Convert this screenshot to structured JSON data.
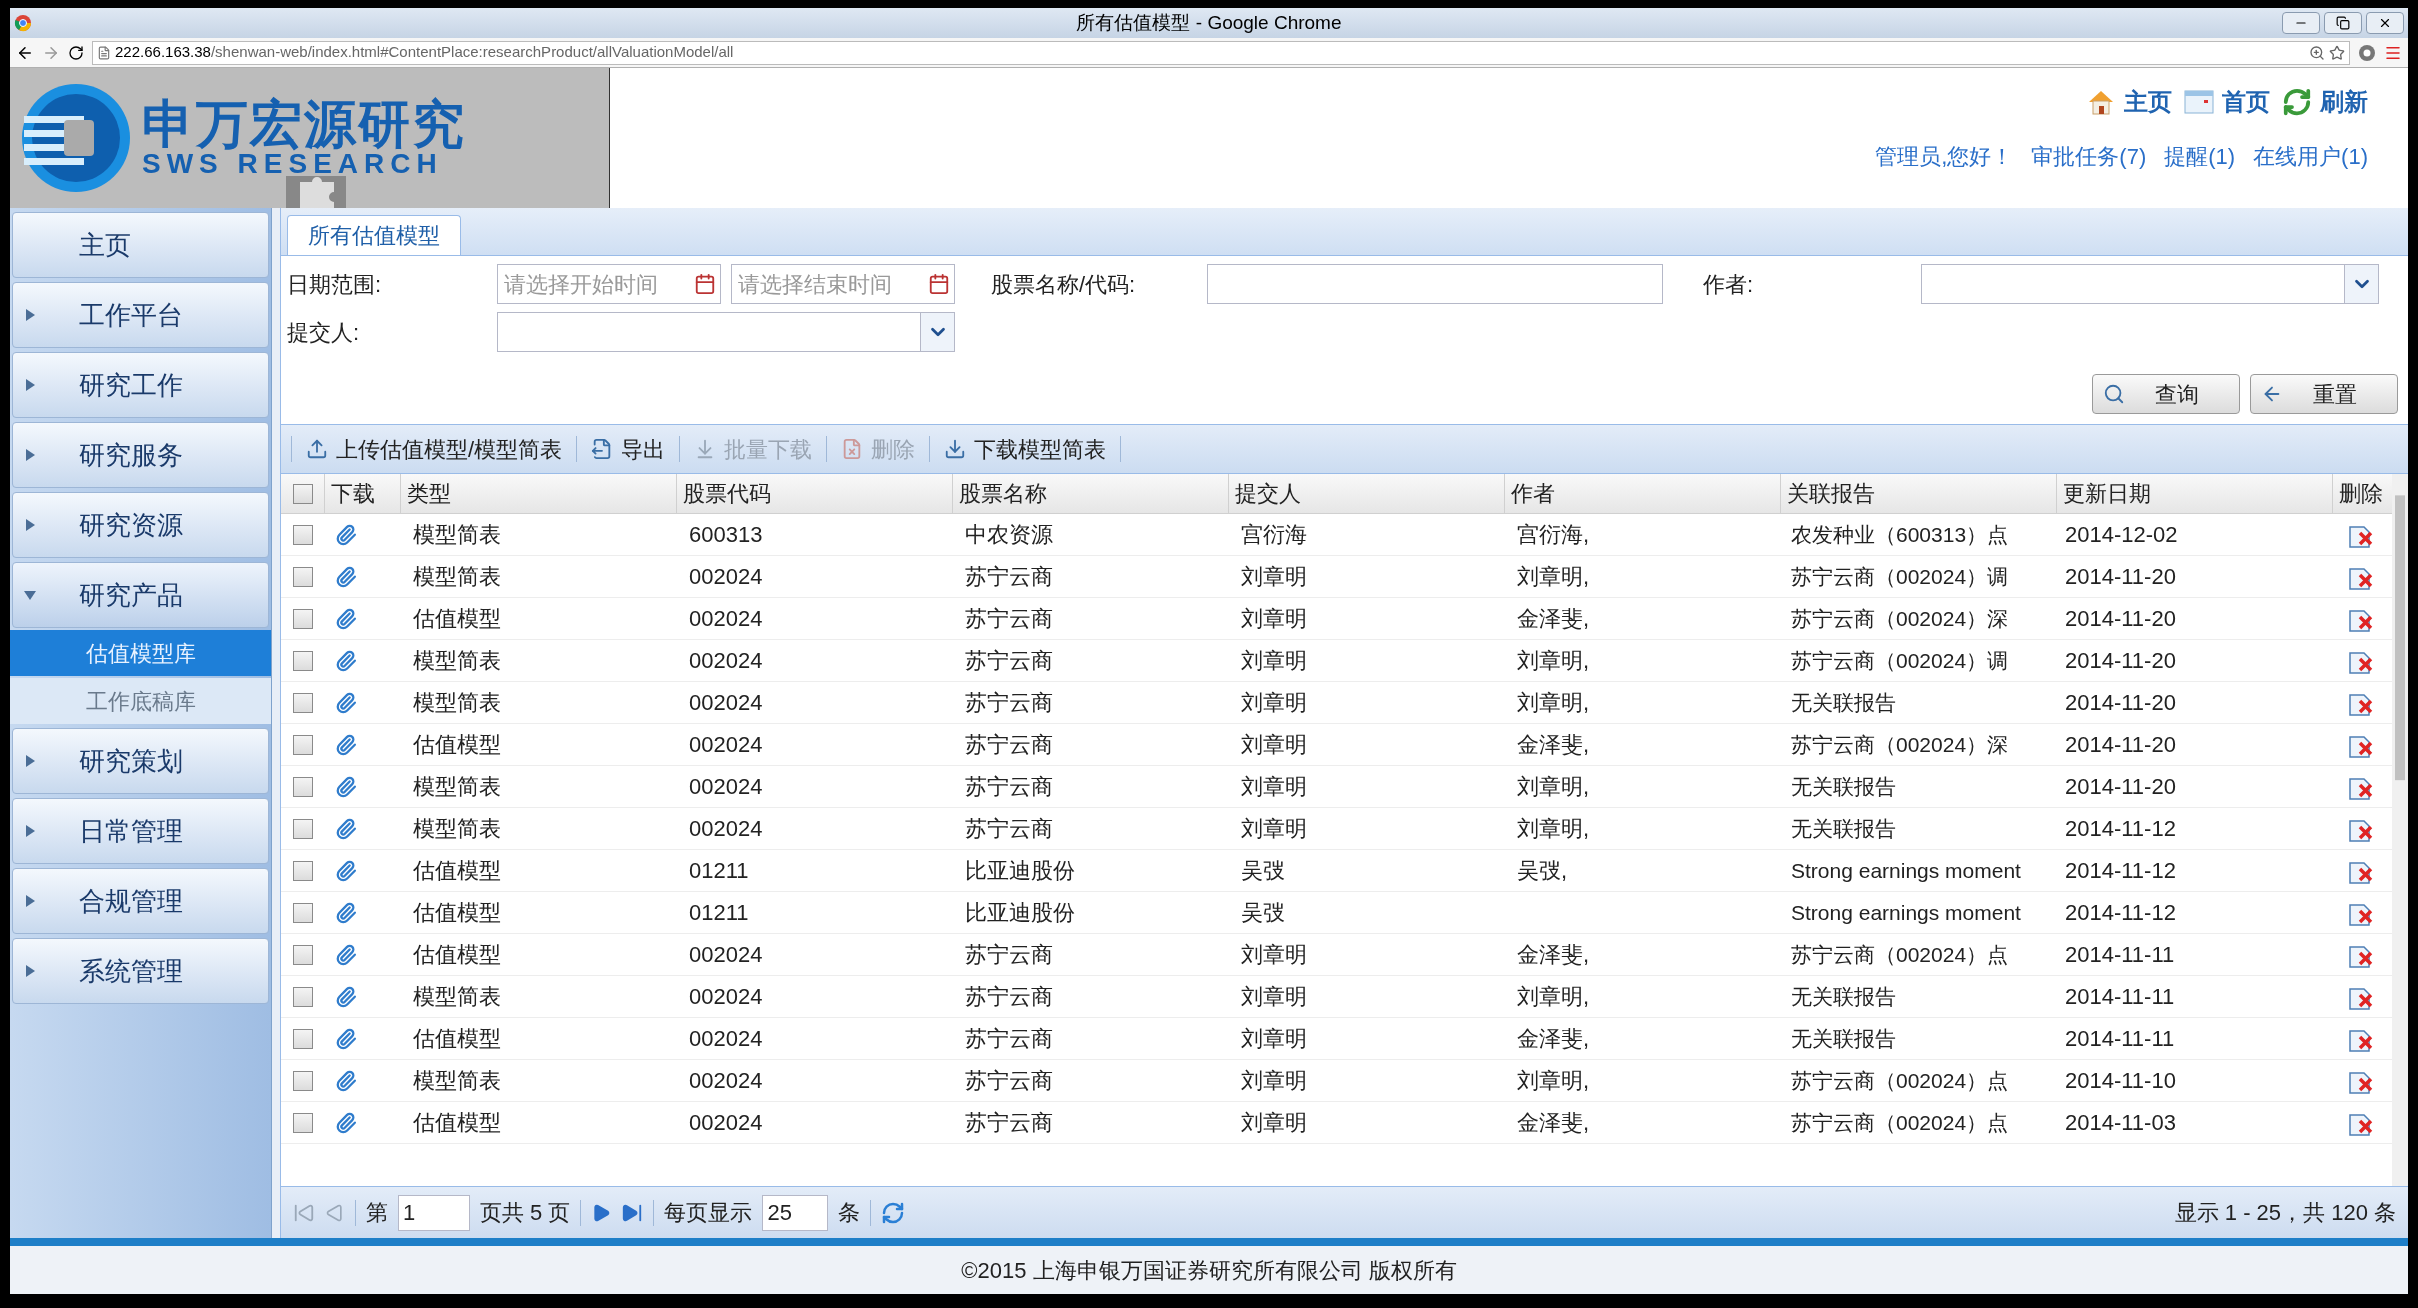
{
  "browser": {
    "title": "所有估值模型 - Google Chrome",
    "url_host": "222.66.163.38",
    "url_path": "/shenwan-web/index.html#ContentPlace:researchProduct/allValuationModel/all"
  },
  "header": {
    "logo": {
      "name": "申万宏源研究",
      "sub": "SWS RESEARCH"
    },
    "nav_links": [
      {
        "label": "主页",
        "kind": "home"
      },
      {
        "label": "首页",
        "kind": "start"
      },
      {
        "label": "刷新",
        "kind": "refresh"
      }
    ],
    "user_links": [
      "管理员,您好！",
      "审批任务(7)",
      "提醒(1)",
      "在线用户(1)"
    ]
  },
  "sidebar": {
    "items": [
      {
        "label": "主页",
        "kind": "link"
      },
      {
        "label": "工作平台",
        "kind": "group",
        "expanded": false
      },
      {
        "label": "研究工作",
        "kind": "group",
        "expanded": false
      },
      {
        "label": "研究服务",
        "kind": "group",
        "expanded": false
      },
      {
        "label": "研究资源",
        "kind": "group",
        "expanded": false
      },
      {
        "label": "研究产品",
        "kind": "group",
        "expanded": true,
        "children": [
          {
            "label": "估值模型库",
            "selected": true
          },
          {
            "label": "工作底稿库",
            "selected": false
          }
        ]
      },
      {
        "label": "研究策划",
        "kind": "group",
        "expanded": false
      },
      {
        "label": "日常管理",
        "kind": "group",
        "expanded": false
      },
      {
        "label": "合规管理",
        "kind": "group",
        "expanded": false
      },
      {
        "label": "系统管理",
        "kind": "group",
        "expanded": false
      }
    ]
  },
  "tabs": [
    {
      "label": "所有估值模型",
      "selected": true
    }
  ],
  "filters": {
    "date_label": "日期范围:",
    "start_placeholder": "请选择开始时间",
    "end_placeholder": "请选择结束时间",
    "stock_label": "股票名称/代码:",
    "author_label": "作者:",
    "submitter_label": "提交人:"
  },
  "buttons": [
    {
      "label": "查询",
      "kind": "search"
    },
    {
      "label": "重置",
      "kind": "reset"
    }
  ],
  "toolbar": [
    {
      "label": "上传估值模型/模型简表",
      "kind": "upload",
      "disabled": false
    },
    {
      "label": "导出",
      "kind": "export",
      "disabled": false
    },
    {
      "label": "批量下载",
      "kind": "batch",
      "disabled": true
    },
    {
      "label": "删除",
      "kind": "delete",
      "disabled": true
    },
    {
      "label": "下载模型简表",
      "kind": "download",
      "disabled": false
    }
  ],
  "table": {
    "all_checked": false,
    "columns": [
      "下载",
      "类型",
      "股票代码",
      "股票名称",
      "提交人",
      "作者",
      "关联报告",
      "更新日期",
      "删除"
    ],
    "rows": [
      {
        "checked": false,
        "type": "模型简表",
        "code": "600313",
        "name": "中农资源",
        "submitter": "宫衍海",
        "author": "宫衍海,",
        "report": "农发种业（600313）点",
        "date": "2014-12-02"
      },
      {
        "checked": false,
        "type": "模型简表",
        "code": "002024",
        "name": "苏宁云商",
        "submitter": "刘章明",
        "author": "刘章明,",
        "report": "苏宁云商（002024）调",
        "date": "2014-11-20"
      },
      {
        "checked": false,
        "type": "估值模型",
        "code": "002024",
        "name": "苏宁云商",
        "submitter": "刘章明",
        "author": "金泽斐,",
        "report": "苏宁云商（002024）深",
        "date": "2014-11-20"
      },
      {
        "checked": false,
        "type": "模型简表",
        "code": "002024",
        "name": "苏宁云商",
        "submitter": "刘章明",
        "author": "刘章明,",
        "report": "苏宁云商（002024）调",
        "date": "2014-11-20"
      },
      {
        "checked": false,
        "type": "模型简表",
        "code": "002024",
        "name": "苏宁云商",
        "submitter": "刘章明",
        "author": "刘章明,",
        "report": "无关联报告",
        "date": "2014-11-20"
      },
      {
        "checked": false,
        "type": "估值模型",
        "code": "002024",
        "name": "苏宁云商",
        "submitter": "刘章明",
        "author": "金泽斐,",
        "report": "苏宁云商（002024）深",
        "date": "2014-11-20"
      },
      {
        "checked": false,
        "type": "模型简表",
        "code": "002024",
        "name": "苏宁云商",
        "submitter": "刘章明",
        "author": "刘章明,",
        "report": "无关联报告",
        "date": "2014-11-20"
      },
      {
        "checked": false,
        "type": "模型简表",
        "code": "002024",
        "name": "苏宁云商",
        "submitter": "刘章明",
        "author": "刘章明,",
        "report": "无关联报告",
        "date": "2014-11-12"
      },
      {
        "checked": false,
        "type": "估值模型",
        "code": "01211",
        "name": "比亚迪股份",
        "submitter": "吴弢",
        "author": "吴弢,",
        "report": "Strong earnings moment",
        "date": "2014-11-12"
      },
      {
        "checked": false,
        "type": "估值模型",
        "code": "01211",
        "name": "比亚迪股份",
        "submitter": "吴弢",
        "report": "Strong earnings moment",
        "date": "2014-11-12"
      },
      {
        "checked": false,
        "type": "估值模型",
        "code": "002024",
        "name": "苏宁云商",
        "submitter": "刘章明",
        "author": "金泽斐,",
        "report": "苏宁云商（002024）点",
        "date": "2014-11-11"
      },
      {
        "checked": false,
        "type": "模型简表",
        "code": "002024",
        "name": "苏宁云商",
        "submitter": "刘章明",
        "author": "刘章明,",
        "report": "无关联报告",
        "date": "2014-11-11"
      },
      {
        "checked": false,
        "type": "估值模型",
        "code": "002024",
        "name": "苏宁云商",
        "submitter": "刘章明",
        "author": "金泽斐,",
        "report": "无关联报告",
        "date": "2014-11-11"
      },
      {
        "checked": false,
        "type": "模型简表",
        "code": "002024",
        "name": "苏宁云商",
        "submitter": "刘章明",
        "author": "刘章明,",
        "report": "苏宁云商（002024）点",
        "date": "2014-11-10"
      },
      {
        "checked": false,
        "type": "估值模型",
        "code": "002024",
        "name": "苏宁云商",
        "submitter": "刘章明",
        "author": "金泽斐,",
        "report": "苏宁云商（002024）点",
        "date": "2014-11-03"
      }
    ]
  },
  "pagination": {
    "page_prefix": "第",
    "page": "1",
    "page_suffix": "页共 5 页",
    "per_page_label": "每页显示",
    "per_page": "25",
    "per_page_suffix": "条",
    "summary": "显示 1 - 25，共 120 条"
  },
  "footer": "©2015 上海申银万国证券研究所有限公司 版权所有"
}
